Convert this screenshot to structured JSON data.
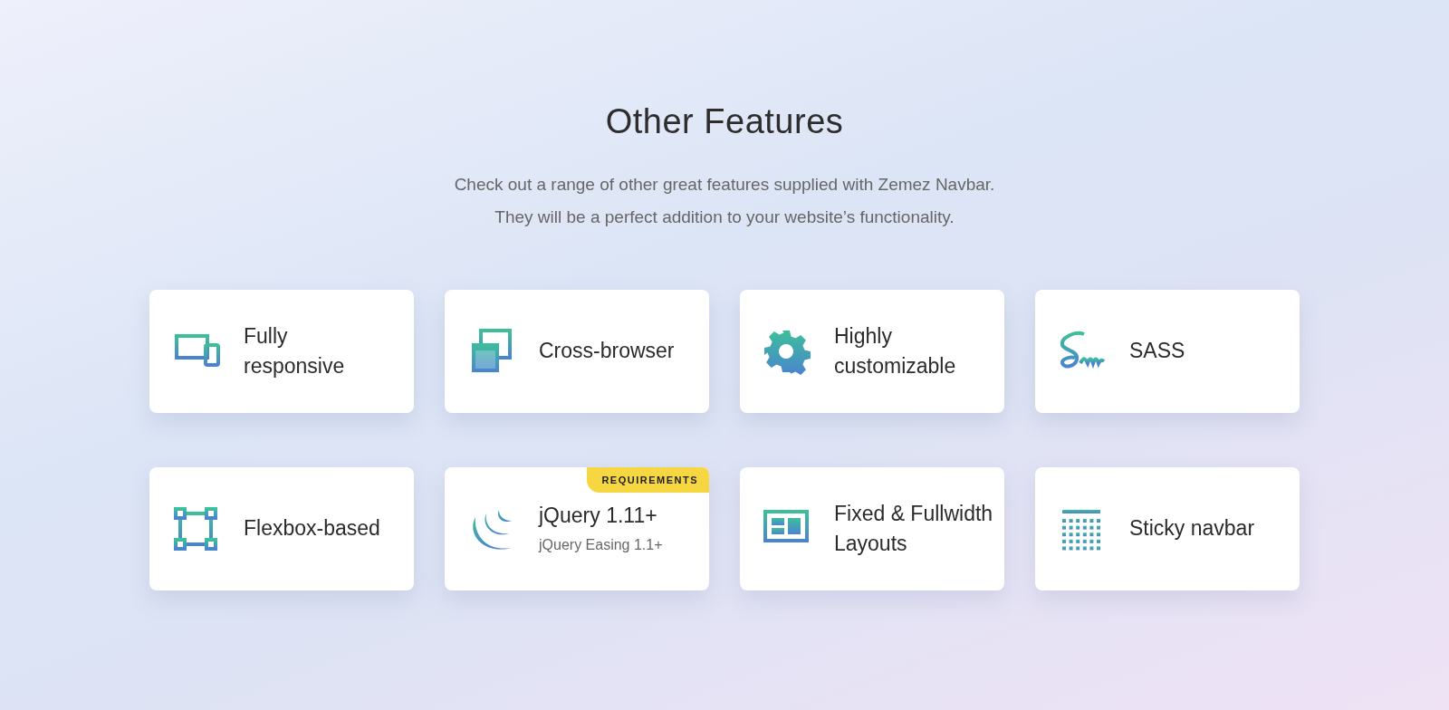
{
  "heading": "Other Features",
  "intro": [
    "Check out a range of other great features supplied with Zemez Navbar.",
    "They will be a perfect addition to your website’s functionality."
  ],
  "features": [
    {
      "title": "Fully\nresponsive"
    },
    {
      "title": "Cross-browser"
    },
    {
      "title": "Highly\ncustomizable"
    },
    {
      "title": "SASS"
    },
    {
      "title": "Flexbox-based"
    },
    {
      "title": "jQuery 1.11+",
      "subtitle": "jQuery Easing 1.1+",
      "badge": "REQUIREMENTS"
    },
    {
      "title": "Fixed & Fullwidth\nLayouts"
    },
    {
      "title": "Sticky navbar"
    }
  ]
}
